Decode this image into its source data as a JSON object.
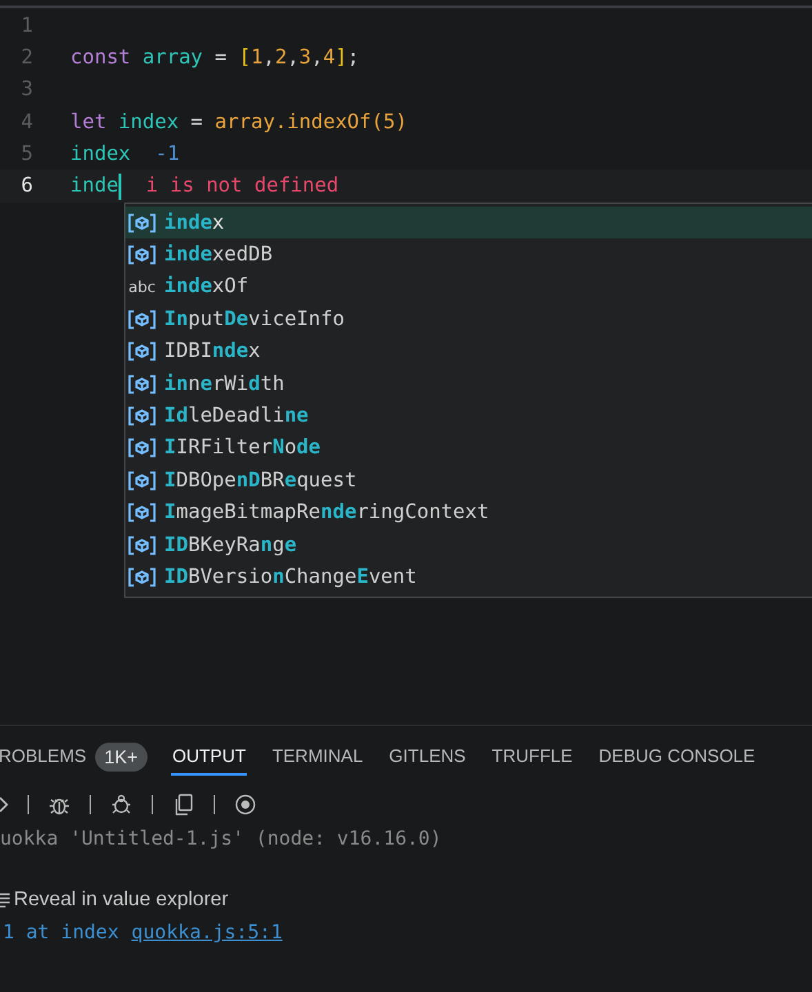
{
  "editor": {
    "lines": [
      {
        "number": "1",
        "current": false
      },
      {
        "number": "2",
        "current": false,
        "tokens": [
          {
            "text": "const ",
            "kind": "keyword"
          },
          {
            "text": "array",
            "kind": "variable"
          },
          {
            "text": " = ",
            "kind": "operator"
          },
          {
            "text": "[",
            "kind": "bracket"
          },
          {
            "text": "1",
            "kind": "number"
          },
          {
            "text": ",",
            "kind": "punct"
          },
          {
            "text": "2",
            "kind": "number"
          },
          {
            "text": ",",
            "kind": "punct"
          },
          {
            "text": "3",
            "kind": "number"
          },
          {
            "text": ",",
            "kind": "punct"
          },
          {
            "text": "4",
            "kind": "number"
          },
          {
            "text": "]",
            "kind": "bracket"
          },
          {
            "text": ";",
            "kind": "punct"
          }
        ]
      },
      {
        "number": "3",
        "current": false
      },
      {
        "number": "4",
        "current": false,
        "tokens": [
          {
            "text": "let ",
            "kind": "keyword"
          },
          {
            "text": "index",
            "kind": "variable"
          },
          {
            "text": " = ",
            "kind": "operator"
          },
          {
            "text": "array.indexOf(5)",
            "kind": "function"
          }
        ]
      },
      {
        "number": "5",
        "current": false,
        "tokens": [
          {
            "text": "index",
            "kind": "variable"
          }
        ],
        "value": "-1"
      },
      {
        "number": "6",
        "current": true,
        "cursor": true,
        "tokens": [
          {
            "text": "inde",
            "kind": "variable"
          }
        ],
        "error": "i is not defined"
      }
    ]
  },
  "suggestions": [
    {
      "kind": "variable",
      "selected": true,
      "segments": [
        {
          "text": "inde",
          "match": true
        },
        {
          "text": "x",
          "match": false
        }
      ]
    },
    {
      "kind": "variable",
      "selected": false,
      "segments": [
        {
          "text": "inde",
          "match": true
        },
        {
          "text": "xedDB",
          "match": false
        }
      ]
    },
    {
      "kind": "word",
      "icon_text": "abc",
      "selected": false,
      "segments": [
        {
          "text": "inde",
          "match": true
        },
        {
          "text": "xOf",
          "match": false
        }
      ]
    },
    {
      "kind": "variable",
      "selected": false,
      "segments": [
        {
          "text": "In",
          "match": true
        },
        {
          "text": "put",
          "match": false
        },
        {
          "text": "De",
          "match": true
        },
        {
          "text": "viceInfo",
          "match": false
        }
      ]
    },
    {
      "kind": "variable",
      "selected": false,
      "segments": [
        {
          "text": "IDBI",
          "match": false
        },
        {
          "text": "nde",
          "match": true
        },
        {
          "text": "x",
          "match": false
        }
      ]
    },
    {
      "kind": "variable",
      "selected": false,
      "segments": [
        {
          "text": "in",
          "match": true
        },
        {
          "text": "n",
          "match": false
        },
        {
          "text": "e",
          "match": true
        },
        {
          "text": "rWi",
          "match": false
        },
        {
          "text": "d",
          "match": true
        },
        {
          "text": "th",
          "match": false
        }
      ]
    },
    {
      "kind": "variable",
      "selected": false,
      "segments": [
        {
          "text": "Id",
          "match": true
        },
        {
          "text": "leDeadli",
          "match": false
        },
        {
          "text": "ne",
          "match": true
        }
      ]
    },
    {
      "kind": "variable",
      "selected": false,
      "segments": [
        {
          "text": "I",
          "match": true
        },
        {
          "text": "IRFilter",
          "match": false
        },
        {
          "text": "N",
          "match": true
        },
        {
          "text": "o",
          "match": false
        },
        {
          "text": "de",
          "match": true
        }
      ]
    },
    {
      "kind": "variable",
      "selected": false,
      "segments": [
        {
          "text": "I",
          "match": true
        },
        {
          "text": "DBOpe",
          "match": false
        },
        {
          "text": "nD",
          "match": true
        },
        {
          "text": "BR",
          "match": false
        },
        {
          "text": "e",
          "match": true
        },
        {
          "text": "quest",
          "match": false
        }
      ]
    },
    {
      "kind": "variable",
      "selected": false,
      "segments": [
        {
          "text": "I",
          "match": true
        },
        {
          "text": "mageBitmapRe",
          "match": false
        },
        {
          "text": "nde",
          "match": true
        },
        {
          "text": "ringContext",
          "match": false
        }
      ]
    },
    {
      "kind": "variable",
      "selected": false,
      "segments": [
        {
          "text": "ID",
          "match": true
        },
        {
          "text": "BKeyRa",
          "match": false
        },
        {
          "text": "n",
          "match": true
        },
        {
          "text": "g",
          "match": false
        },
        {
          "text": "e",
          "match": true
        }
      ]
    },
    {
      "kind": "variable",
      "selected": false,
      "segments": [
        {
          "text": "ID",
          "match": true
        },
        {
          "text": "BVersio",
          "match": false
        },
        {
          "text": "n",
          "match": true
        },
        {
          "text": "Change",
          "match": false
        },
        {
          "text": "E",
          "match": true
        },
        {
          "text": "vent",
          "match": false
        }
      ]
    }
  ],
  "panel": {
    "tabs": [
      {
        "label": "ROBLEMS",
        "selected": false,
        "badge": "1K+"
      },
      {
        "label": "OUTPUT",
        "selected": true
      },
      {
        "label": "TERMINAL",
        "selected": false
      },
      {
        "label": "GITLENS",
        "selected": false
      },
      {
        "label": "TRUFFLE",
        "selected": false
      },
      {
        "label": "DEBUG CONSOLE",
        "selected": false
      }
    ],
    "output": [
      {
        "kind": "header",
        "text": "uokka 'Untitled-1.js' (node: v16.16.0)"
      },
      {
        "kind": "action",
        "text": "Reveal in value explorer"
      },
      {
        "kind": "result",
        "text": "1 at index",
        "link": "quokka.js:5:1"
      }
    ]
  }
}
